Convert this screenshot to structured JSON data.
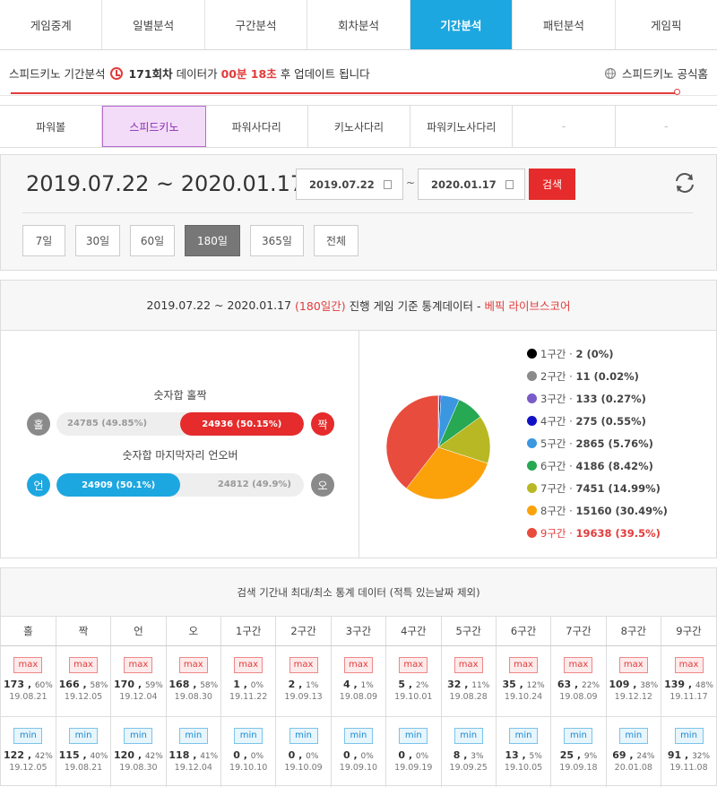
{
  "nav": {
    "tabs": [
      "게임중계",
      "일별분석",
      "구간분석",
      "회차분석",
      "기간분석",
      "패턴분석",
      "게임픽"
    ],
    "active": 4
  },
  "info": {
    "prefix": "스피드키노 기간분석",
    "round": "171회차",
    "mid": "데이터가",
    "time": "00분 18초",
    "suffix": "후 업데이트 됩니다",
    "official": "스피드키노 공식홈"
  },
  "subnav": {
    "tabs": [
      "파워볼",
      "스피드키노",
      "파워사다리",
      "키노사다리",
      "파워키노사다리",
      "-",
      "-"
    ],
    "active": 1
  },
  "period": {
    "range": "2019.07.22 ~ 2020.01.17",
    "start_date": "2019.07.22",
    "tilde": "~",
    "end_date": "2020.01.17",
    "search_label": "검색",
    "days": [
      "7일",
      "30일",
      "60일",
      "180일",
      "365일",
      "전체"
    ],
    "active_day": 3
  },
  "stats": {
    "title_main": "2019.07.22 ~ 2020.01.17",
    "title_days": "(180일간)",
    "title_mid": "진행 게임 기준 통계데이터 -",
    "title_source": "베픽 라이브스코어",
    "oddeven": {
      "title": "숫자합 홀짝",
      "left_label": "홀",
      "right_label": "짝",
      "left_value": "24785 (49.85%)",
      "right_value": "24936 (50.15%)",
      "right_pct": 50.15
    },
    "underover": {
      "title": "숫자합 마지막자리 언오버",
      "left_label": "언",
      "right_label": "오",
      "left_value": "24909 (50.1%)",
      "right_value": "24812 (49.9%)",
      "left_pct": 50.1
    }
  },
  "chart_data": {
    "type": "pie",
    "categories": [
      "1구간",
      "2구간",
      "3구간",
      "4구간",
      "5구간",
      "6구간",
      "7구간",
      "8구간",
      "9구간"
    ],
    "values": [
      2,
      11,
      133,
      275,
      2865,
      4186,
      7451,
      15160,
      19638
    ],
    "labels": [
      "2 (0%)",
      "11 (0.02%)",
      "133 (0.27%)",
      "275 (0.55%)",
      "2865 (5.76%)",
      "4186 (8.42%)",
      "7451 (14.99%)",
      "15160 (30.49%)",
      "19638 (39.5%)"
    ],
    "colors": [
      "#000000",
      "#8a8a8a",
      "#7a5cc8",
      "#1010c8",
      "#3a97e0",
      "#27a853",
      "#b7b823",
      "#fba20b",
      "#e84c3d"
    ],
    "highlight": 8
  },
  "minmax": {
    "title": "검색 기간내 최대/최소 통계 데이터 (적특 있는날짜 제외)",
    "columns": [
      "홀",
      "짝",
      "언",
      "오",
      "1구간",
      "2구간",
      "3구간",
      "4구간",
      "5구간",
      "6구간",
      "7구간",
      "8구간",
      "9구간"
    ],
    "max_label": "max",
    "min_label": "min",
    "max": [
      {
        "v": "173",
        "p": "60%",
        "d": "19.08.21"
      },
      {
        "v": "166",
        "p": "58%",
        "d": "19.12.05"
      },
      {
        "v": "170",
        "p": "59%",
        "d": "19.12.04"
      },
      {
        "v": "168",
        "p": "58%",
        "d": "19.08.30"
      },
      {
        "v": "1",
        "p": "0%",
        "d": "19.11.22"
      },
      {
        "v": "2",
        "p": "1%",
        "d": "19.09.13"
      },
      {
        "v": "4",
        "p": "1%",
        "d": "19.08.09"
      },
      {
        "v": "5",
        "p": "2%",
        "d": "19.10.01"
      },
      {
        "v": "32",
        "p": "11%",
        "d": "19.08.28"
      },
      {
        "v": "35",
        "p": "12%",
        "d": "19.10.24"
      },
      {
        "v": "63",
        "p": "22%",
        "d": "19.08.09"
      },
      {
        "v": "109",
        "p": "38%",
        "d": "19.12.12"
      },
      {
        "v": "139",
        "p": "48%",
        "d": "19.11.17"
      }
    ],
    "min": [
      {
        "v": "122",
        "p": "42%",
        "d": "19.12.05"
      },
      {
        "v": "115",
        "p": "40%",
        "d": "19.08.21"
      },
      {
        "v": "120",
        "p": "42%",
        "d": "19.08.30"
      },
      {
        "v": "118",
        "p": "41%",
        "d": "19.12.04"
      },
      {
        "v": "0",
        "p": "0%",
        "d": "19.10.10"
      },
      {
        "v": "0",
        "p": "0%",
        "d": "19.10.09"
      },
      {
        "v": "0",
        "p": "0%",
        "d": "19.09.10"
      },
      {
        "v": "0",
        "p": "0%",
        "d": "19.09.19"
      },
      {
        "v": "8",
        "p": "3%",
        "d": "19.09.25"
      },
      {
        "v": "13",
        "p": "5%",
        "d": "19.10.05"
      },
      {
        "v": "25",
        "p": "9%",
        "d": "19.09.18"
      },
      {
        "v": "69",
        "p": "24%",
        "d": "20.01.08"
      },
      {
        "v": "91",
        "p": "32%",
        "d": "19.11.08"
      }
    ]
  }
}
